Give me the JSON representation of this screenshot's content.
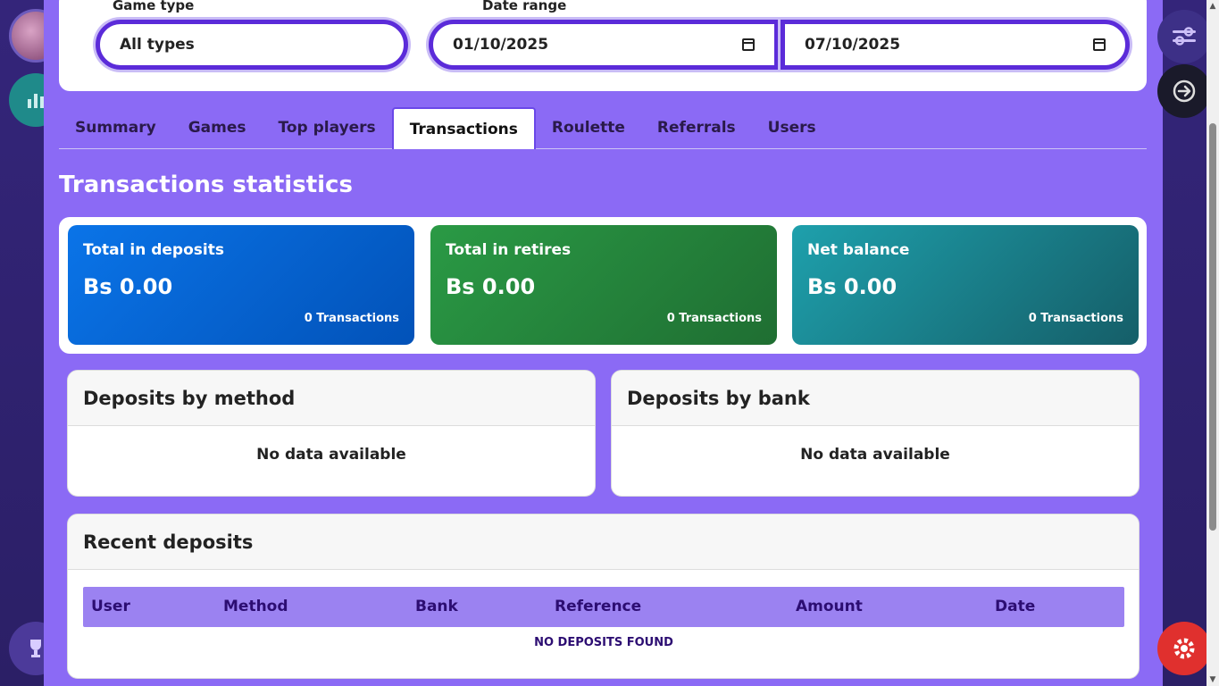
{
  "filters": {
    "game_type_label": "Game type",
    "game_type_value": "All types",
    "date_range_label": "Date range",
    "date_from": "01/10/2025",
    "date_to": "07/10/2025"
  },
  "tabs": [
    {
      "label": "Summary"
    },
    {
      "label": "Games"
    },
    {
      "label": "Top players"
    },
    {
      "label": "Transactions",
      "active": true
    },
    {
      "label": "Roulette"
    },
    {
      "label": "Referrals"
    },
    {
      "label": "Users"
    }
  ],
  "section_title": "Transactions statistics",
  "cards": [
    {
      "title": "Total in deposits",
      "value": "Bs 0.00",
      "count": "0 Transactions"
    },
    {
      "title": "Total in retires",
      "value": "Bs 0.00",
      "count": "0 Transactions"
    },
    {
      "title": "Net balance",
      "value": "Bs 0.00",
      "count": "0 Transactions"
    }
  ],
  "deposits_by_method": {
    "title": "Deposits by method",
    "empty": "No data available"
  },
  "deposits_by_bank": {
    "title": "Deposits by bank",
    "empty": "No data available"
  },
  "recent_deposits": {
    "title": "Recent deposits",
    "columns": [
      "User",
      "Method",
      "Bank",
      "Reference",
      "Amount",
      "Date"
    ],
    "empty": "NO DEPOSITS FOUND"
  },
  "colors": {
    "accent": "#8b6af5",
    "deposit_card": "#0a74e8",
    "retire_card": "#2a9a45",
    "net_card": "#1ea0ac",
    "table_header": "#9b82f1"
  }
}
